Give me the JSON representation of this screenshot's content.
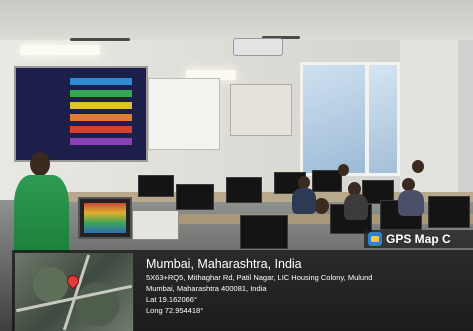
{
  "gps_badge": {
    "label": "GPS Map C"
  },
  "location": {
    "city": "Mumbai, Maharashtra, India",
    "address_line1": "5X63+RQ5, Mithaghar Rd, Patil Nagar, LIC Housing Colony, Mulund",
    "address_line2": "Mumbai, Maharashtra 400081, India",
    "latitude": "Lat 19.162066°",
    "longitude": "Long 72.954418°"
  }
}
